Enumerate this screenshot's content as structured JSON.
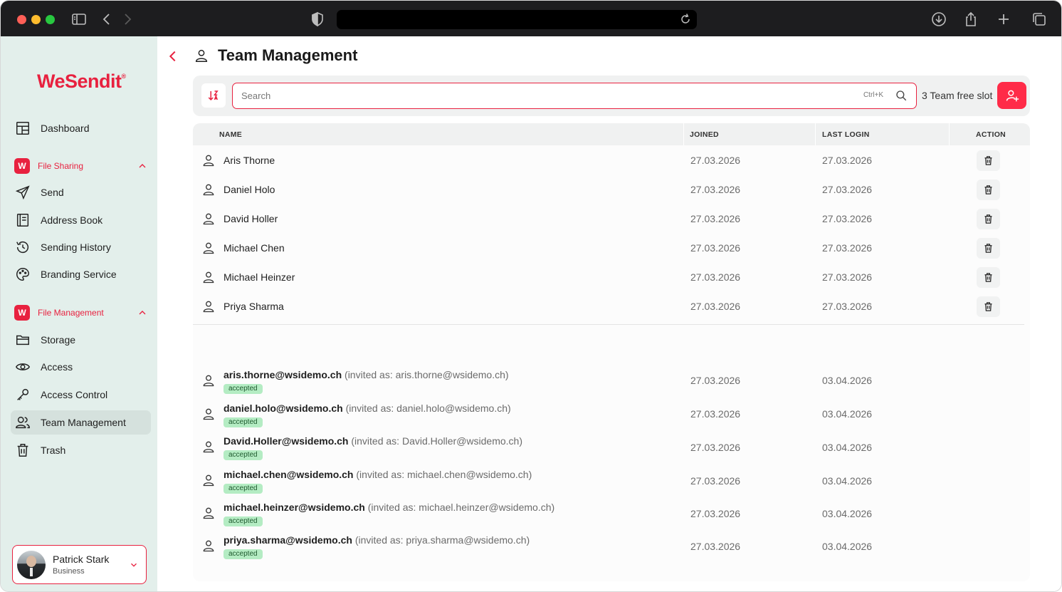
{
  "app": {
    "logo_text": "WeSendit",
    "logo_mark": "®",
    "page_title": "Team Management"
  },
  "sidebar": {
    "dashboard_label": "Dashboard",
    "file_sharing": {
      "badge": "W",
      "label": "File Sharing",
      "items": [
        "Send",
        "Address Book",
        "Sending History",
        "Branding Service"
      ]
    },
    "file_management": {
      "badge": "W",
      "label": "File Management",
      "items": [
        "Storage",
        "Access",
        "Access Control",
        "Team Management",
        "Trash"
      ]
    },
    "user": {
      "name": "Patrick Stark",
      "plan": "Business"
    }
  },
  "toolbar": {
    "search_placeholder": "Search",
    "search_shortcut": "Ctrl+K",
    "free_slot_text": "3 Team free slot"
  },
  "table": {
    "headers": {
      "name": "NAME",
      "joined": "JOINED",
      "last_login": "LAST LOGIN",
      "action": "ACTION"
    },
    "members": [
      {
        "name": "Aris Thorne",
        "joined": "27.03.2026",
        "last_login": "27.03.2026"
      },
      {
        "name": "Daniel Holo",
        "joined": "27.03.2026",
        "last_login": "27.03.2026"
      },
      {
        "name": "David Holler",
        "joined": "27.03.2026",
        "last_login": "27.03.2026"
      },
      {
        "name": "Michael Chen",
        "joined": "27.03.2026",
        "last_login": "27.03.2026"
      },
      {
        "name": "Michael Heinzer",
        "joined": "27.03.2026",
        "last_login": "27.03.2026"
      },
      {
        "name": "Priya Sharma",
        "joined": "27.03.2026",
        "last_login": "27.03.2026"
      }
    ],
    "invites": [
      {
        "email": "aris.thorne@wsidemo.ch",
        "invited_as": "(invited as: aris.thorne@wsidemo.ch)",
        "status": "accepted",
        "joined": "27.03.2026",
        "last_login": "03.04.2026"
      },
      {
        "email": "daniel.holo@wsidemo.ch",
        "invited_as": "(invited as: daniel.holo@wsidemo.ch)",
        "status": "accepted",
        "joined": "27.03.2026",
        "last_login": "03.04.2026"
      },
      {
        "email": "David.Holler@wsidemo.ch",
        "invited_as": "(invited as: David.Holler@wsidemo.ch)",
        "status": "accepted",
        "joined": "27.03.2026",
        "last_login": "03.04.2026"
      },
      {
        "email": "michael.chen@wsidemo.ch",
        "invited_as": "(invited as: michael.chen@wsidemo.ch)",
        "status": "accepted",
        "joined": "27.03.2026",
        "last_login": "03.04.2026"
      },
      {
        "email": "michael.heinzer@wsidemo.ch",
        "invited_as": "(invited as: michael.heinzer@wsidemo.ch)",
        "status": "accepted",
        "joined": "27.03.2026",
        "last_login": "03.04.2026"
      },
      {
        "email": "priya.sharma@wsidemo.ch",
        "invited_as": "(invited as: priya.sharma@wsidemo.ch)",
        "status": "accepted",
        "joined": "27.03.2026",
        "last_login": "03.04.2026"
      }
    ]
  },
  "colors": {
    "brand": "#e8213f",
    "sidebar_bg": "#e3efeb",
    "accepted_badge_bg": "#b4ecc3"
  },
  "icons": {
    "browser": [
      "sidebar-toggle-icon",
      "back-icon",
      "forward-icon",
      "shield-icon",
      "reload-icon",
      "download-icon",
      "share-icon",
      "new-tab-icon",
      "tabs-overview-icon"
    ],
    "nav": [
      "dashboard-icon",
      "send-icon",
      "address-book-icon",
      "history-icon",
      "palette-icon",
      "folder-icon",
      "eye-icon",
      "key-icon",
      "team-icon",
      "trash-icon"
    ]
  }
}
